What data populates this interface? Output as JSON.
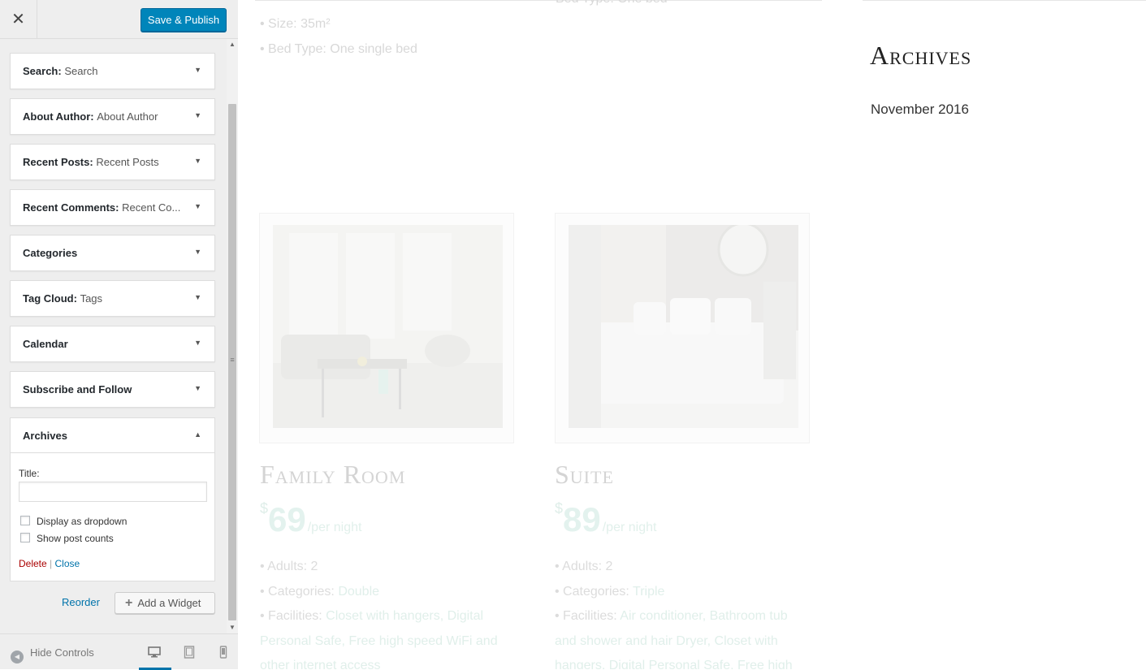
{
  "header": {
    "close_glyph": "✕",
    "publish_label": "Save & Publish"
  },
  "widgets": [
    {
      "name": "Search",
      "sep": ":",
      "subtitle": "Search"
    },
    {
      "name": "About Author",
      "sep": ":",
      "subtitle": "About Author"
    },
    {
      "name": "Recent Posts",
      "sep": ":",
      "subtitle": "Recent Posts"
    },
    {
      "name": "Recent Comments",
      "sep": ":",
      "subtitle": "Recent Co..."
    },
    {
      "name": "Categories",
      "sep": "",
      "subtitle": ""
    },
    {
      "name": "Tag Cloud",
      "sep": ":",
      "subtitle": "Tags"
    },
    {
      "name": "Calendar",
      "sep": "",
      "subtitle": ""
    },
    {
      "name": "Subscribe and Follow",
      "sep": "",
      "subtitle": ""
    }
  ],
  "archives_widget": {
    "name": "Archives",
    "title_label": "Title:",
    "title_value": "",
    "opt_dropdown": "Display as dropdown",
    "opt_counts": "Show post counts",
    "delete_label": "Delete",
    "divider": "|",
    "close_label": "Close"
  },
  "actions": {
    "reorder_label": "Reorder",
    "add_widget_label": "Add a Widget"
  },
  "footer": {
    "hide_controls_label": "Hide Controls"
  },
  "preview": {
    "spec_size": "• Size: 35m²",
    "spec_bed": "• Bed Type: One single bed",
    "spec_top_right": "Bed Type: One bed",
    "rooms": [
      {
        "title": "Family Room",
        "currency": "$",
        "price": "69",
        "per": "/per night",
        "adults": "• Adults: 2",
        "categories_label": "• Categories: ",
        "categories_value": "Double",
        "facilities_label": "• Facilities: ",
        "facilities_value": "Closet with hangers, Digital Personal Safe, Free high speed WiFi and other internet access"
      },
      {
        "title": "Suite",
        "currency": "$",
        "price": "89",
        "per": "/per night",
        "adults": "• Adults: 2",
        "categories_label": "• Categories: ",
        "categories_value": "Triple",
        "facilities_label": "• Facilities: ",
        "facilities_value": "Air conditioner, Bathroom tub and shower and hair Dryer, Closet with hangers, Digital Personal Safe, Free high"
      }
    ],
    "archives_heading": "Archives",
    "archives_month": "November 2016"
  },
  "colors": {
    "primary_button": "#0085ba",
    "link": "#0073aa",
    "delete": "#aa0000",
    "sidebar_bg": "#eeeeee"
  }
}
